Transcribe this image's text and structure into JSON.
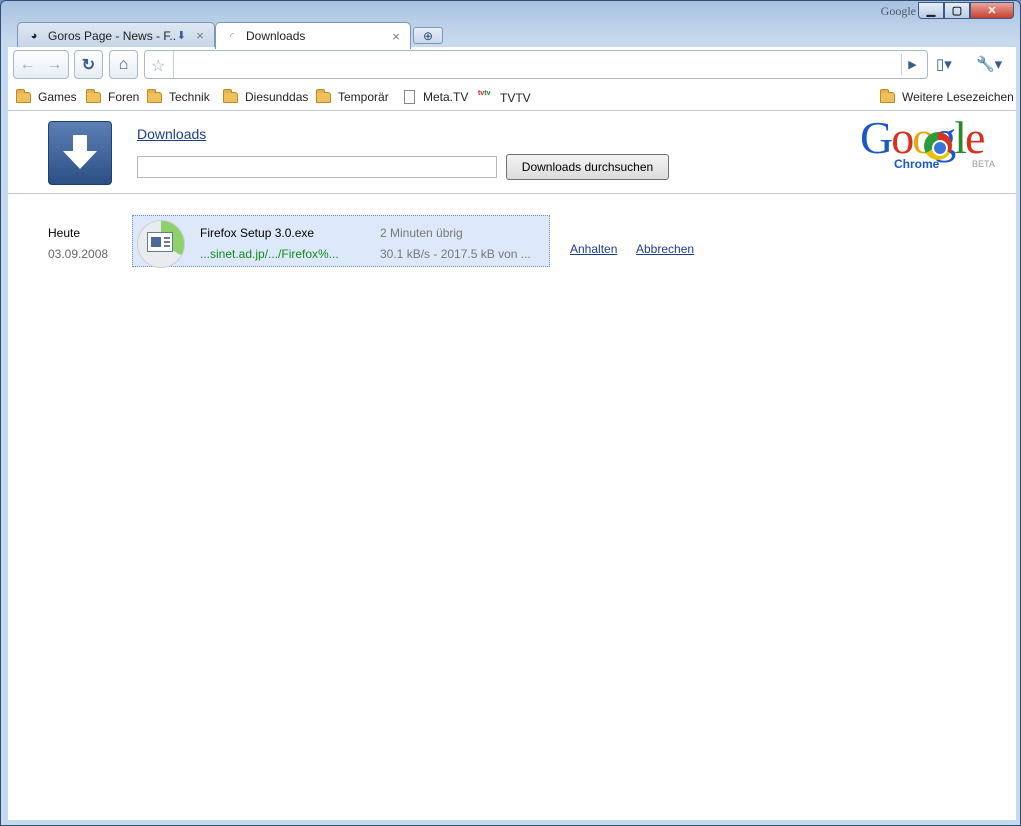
{
  "window": {
    "os_label": "Google"
  },
  "tabs": [
    {
      "title": "Goros Page - News - F..."
    },
    {
      "title": "Downloads"
    }
  ],
  "toolbar": {
    "omnibox_value": ""
  },
  "bookmarks": {
    "items": [
      "Games",
      "Foren",
      "Technik",
      "Diesunddas",
      "Temporär",
      "Meta.TV",
      "TVTV"
    ],
    "other": "Weitere Lesezeichen"
  },
  "page": {
    "title": "Downloads",
    "search_button": "Downloads durchsuchen",
    "search_value": "",
    "brand": {
      "word": "Google",
      "product": "Chrome",
      "badge": "BETA"
    }
  },
  "downloads": {
    "date_label": "Heute",
    "date_value": "03.09.2008",
    "item": {
      "filename": "Firefox Setup 3.0.exe",
      "url": "...sinet.ad.jp/.../Firefox%...",
      "time_left": "2 Minuten übrig",
      "speed": "30.1 kB/s - 2017.5 kB von ...",
      "progress_fraction": 0.33,
      "pause_label": "Anhalten",
      "cancel_label": "Abbrechen"
    }
  }
}
